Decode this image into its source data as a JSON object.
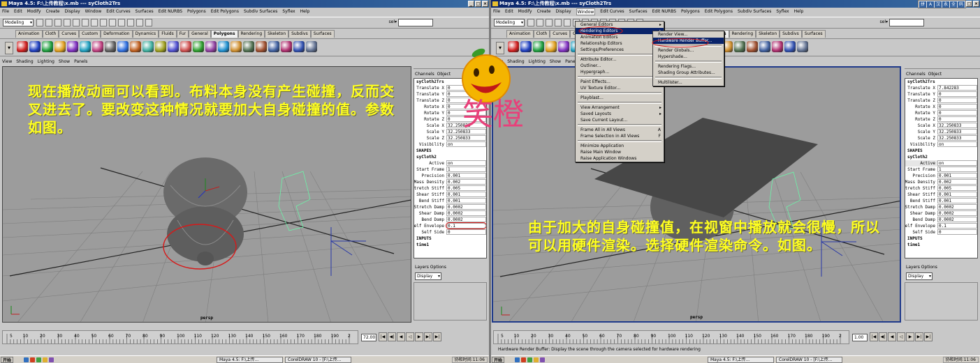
{
  "window1": {
    "title": "Maya 4.5: F:\\上传教程\\x.mb  ---  syCloth2Trs",
    "menus": [
      "File",
      "Edit",
      "Modify",
      "Create",
      "Display",
      "Window",
      "Edit Curves",
      "Surfaces",
      "Edit NURBS",
      "Polygons",
      "Edit Polygons",
      "Subdiv Surfaces",
      "Syflex",
      "Help"
    ],
    "mode": "Modeling",
    "sel_label": "sel▾",
    "shelf_tabs": [
      "Animation",
      "Cloth",
      "Curves",
      "Custom",
      "Deformation",
      "Dynamics",
      "Fluids",
      "Fur",
      "General",
      "Polygons",
      "Rendering",
      "Skeleton",
      "Subdivs",
      "Surfaces"
    ],
    "active_shelf_tab": "Polygons",
    "panel_menus": [
      "View",
      "Shading",
      "Lighting",
      "Show",
      "Panels"
    ],
    "overlay_text": "现在播放动画可以看到。布料本身没有产生碰撞，反而交叉进去了。要改变这种情况就要加大自身碰撞的值。参数如图。",
    "viewport_label": "persp",
    "current_frame": "72.00",
    "channel_box": {
      "tabs": [
        "Channels",
        "Object"
      ],
      "object": "syCloth2Trs",
      "transforms": [
        {
          "label": "Translate X",
          "value": "0"
        },
        {
          "label": "Translate Y",
          "value": "0"
        },
        {
          "label": "Translate Z",
          "value": "0"
        },
        {
          "label": "Rotate X",
          "value": "0"
        },
        {
          "label": "Rotate Y",
          "value": "0"
        },
        {
          "label": "Rotate Z",
          "value": "0"
        },
        {
          "label": "Scale X",
          "value": "32.250833"
        },
        {
          "label": "Scale Y",
          "value": "32.250833"
        },
        {
          "label": "Scale Z",
          "value": "32.250833"
        },
        {
          "label": "Visibility",
          "value": "on"
        }
      ],
      "shapes_header": "SHAPES",
      "shape_name": "syCloth2",
      "shape_attrs": [
        {
          "label": "Active",
          "value": "on"
        },
        {
          "label": "Start Frame",
          "value": "1"
        },
        {
          "label": "Precision",
          "value": "0.001"
        },
        {
          "label": "Mass Density",
          "value": "0.002"
        },
        {
          "label": "Stretch Stiff",
          "value": "0.005"
        },
        {
          "label": "Shear Stiff",
          "value": "0.001"
        },
        {
          "label": "Bend Stiff",
          "value": "0.001"
        },
        {
          "label": "Stretch Damp",
          "value": "0.0002"
        },
        {
          "label": "Shear Damp",
          "value": "0.0002"
        },
        {
          "label": "Bend Damp",
          "value": "0.0002"
        },
        {
          "label": "Self Envelope",
          "value": "0.1"
        },
        {
          "label": "Self Side",
          "value": "0"
        }
      ],
      "inputs_header": "INPUTS",
      "input_name": "time1"
    },
    "layers_tabs": [
      "Layers",
      "Options"
    ],
    "layers_display": "Display"
  },
  "window2": {
    "title": "Maya 4.5: F:\\上传教程\\x.mb  ---  syCloth2Trs",
    "menus": [
      "File",
      "Edit",
      "Modify",
      "Create",
      "Display",
      "Window",
      "Edit Curves",
      "Surfaces",
      "Edit NURBS",
      "Polygons",
      "Edit Polygons",
      "Subdiv Surfaces",
      "Syflex",
      "Help"
    ],
    "active_menu": "Window",
    "mode": "Modeling",
    "sel_label": "sel▾",
    "panel_menus": [
      "View",
      "Shading",
      "Lighting",
      "Show",
      "Panels"
    ],
    "overlay_text": "由于加大的自身碰撞值，在视窗中播放就会很慢，所以可以用硬件渲染。选择硬件渲染命令。如图。",
    "viewport_label": "persp",
    "current_frame": "1.00",
    "status_text": "Hardware Render Buffer: Display the scene through the camera selected for hardware rendering",
    "window_menu": [
      {
        "label": "General Editors",
        "arrow": true
      },
      {
        "label": "Rendering Editors",
        "arrow": true,
        "hl": true
      },
      {
        "label": "Animation Editors",
        "arrow": true
      },
      {
        "label": "Relationship Editors",
        "arrow": true
      },
      {
        "label": "Settings/Preferences",
        "arrow": true
      },
      {
        "sep": true
      },
      {
        "label": "Attribute Editor..."
      },
      {
        "label": "Outliner..."
      },
      {
        "label": "Hypergraph..."
      },
      {
        "sep": true
      },
      {
        "label": "Paint Effects..."
      },
      {
        "label": "UV Texture Editor..."
      },
      {
        "sep": true
      },
      {
        "label": "Playblast..."
      },
      {
        "sep": true
      },
      {
        "label": "View Arrangement",
        "arrow": true
      },
      {
        "label": "Saved Layouts",
        "arrow": true
      },
      {
        "label": "Save Current Layout..."
      },
      {
        "sep": true
      },
      {
        "label": "Frame All in All Views",
        "shortcut": "A"
      },
      {
        "label": "Frame Selection in All Views",
        "shortcut": "F"
      },
      {
        "sep": true
      },
      {
        "label": "Minimize Application"
      },
      {
        "label": "Raise Main Window"
      },
      {
        "label": "Raise Application Windows"
      }
    ],
    "rendering_submenu": [
      {
        "label": "Render View..."
      },
      {
        "label": "Hardware Render Buffer...",
        "hl": true
      },
      {
        "sep": true
      },
      {
        "label": "Render Globals..."
      },
      {
        "label": "Hypershade..."
      },
      {
        "sep": true
      },
      {
        "label": "Rendering Flags..."
      },
      {
        "label": "Shading Group Attributes..."
      },
      {
        "sep": true
      },
      {
        "label": "Multilister..."
      }
    ],
    "channel_box": {
      "tabs": [
        "Channels",
        "Object"
      ],
      "object": "syCloth2Trs",
      "transforms": [
        {
          "label": "Translate X",
          "value": "7.842283"
        },
        {
          "label": "Translate Y",
          "value": "0"
        },
        {
          "label": "Translate Z",
          "value": "0"
        },
        {
          "label": "Rotate X",
          "value": "0"
        },
        {
          "label": "Rotate Y",
          "value": "0"
        },
        {
          "label": "Rotate Z",
          "value": "0"
        },
        {
          "label": "Scale X",
          "value": "32.250833"
        },
        {
          "label": "Scale Y",
          "value": "32.250833"
        },
        {
          "label": "Scale Z",
          "value": "32.250833"
        },
        {
          "label": "Visibility",
          "value": "on"
        }
      ],
      "shapes_header": "SHAPES",
      "shape_name": "syCloth2",
      "shape_attrs": [
        {
          "label": "Active",
          "value": "on",
          "hl": true
        },
        {
          "label": "Start Frame",
          "value": "1"
        },
        {
          "label": "Precision",
          "value": "0.001"
        },
        {
          "label": "Mass Density",
          "value": "0.002"
        },
        {
          "label": "Stretch Stiff",
          "value": "0.005"
        },
        {
          "label": "Shear Stiff",
          "value": "0.001"
        },
        {
          "label": "Bend Stiff",
          "value": "0.001"
        },
        {
          "label": "Stretch Damp",
          "value": "0.0002"
        },
        {
          "label": "Shear Damp",
          "value": "0.0002"
        },
        {
          "label": "Bend Damp",
          "value": "0.0002"
        },
        {
          "label": "Self Envelope",
          "value": "0.1"
        },
        {
          "label": "Self Side",
          "value": "0"
        }
      ],
      "inputs_header": "INPUTS",
      "input_name": "time1"
    },
    "layers_tabs": [
      "Layers",
      "Options"
    ],
    "layers_display": "Display"
  },
  "timeline_ticks": [
    "5",
    "10",
    "20",
    "30",
    "40",
    "50",
    "60",
    "70",
    "80",
    "90",
    "100",
    "110",
    "120",
    "130",
    "140",
    "150",
    "160",
    "170",
    "180",
    "190",
    "2"
  ],
  "taskbar": {
    "start": "开始",
    "tasks": [
      "Maya 4.5: F:\\上传...",
      "CorelDRAW 10 - [F:\\上传..."
    ],
    "clock": "协和时间:11:06"
  },
  "ime_bar": [
    "拼",
    "A",
    "汉",
    "永",
    "全",
    "码"
  ],
  "mascot_text": "笑橙",
  "colors": {
    "overlay": "#ffff20",
    "titlebar": "#0a246a",
    "highlight": "#0a246a",
    "annotation": "#d81818"
  }
}
